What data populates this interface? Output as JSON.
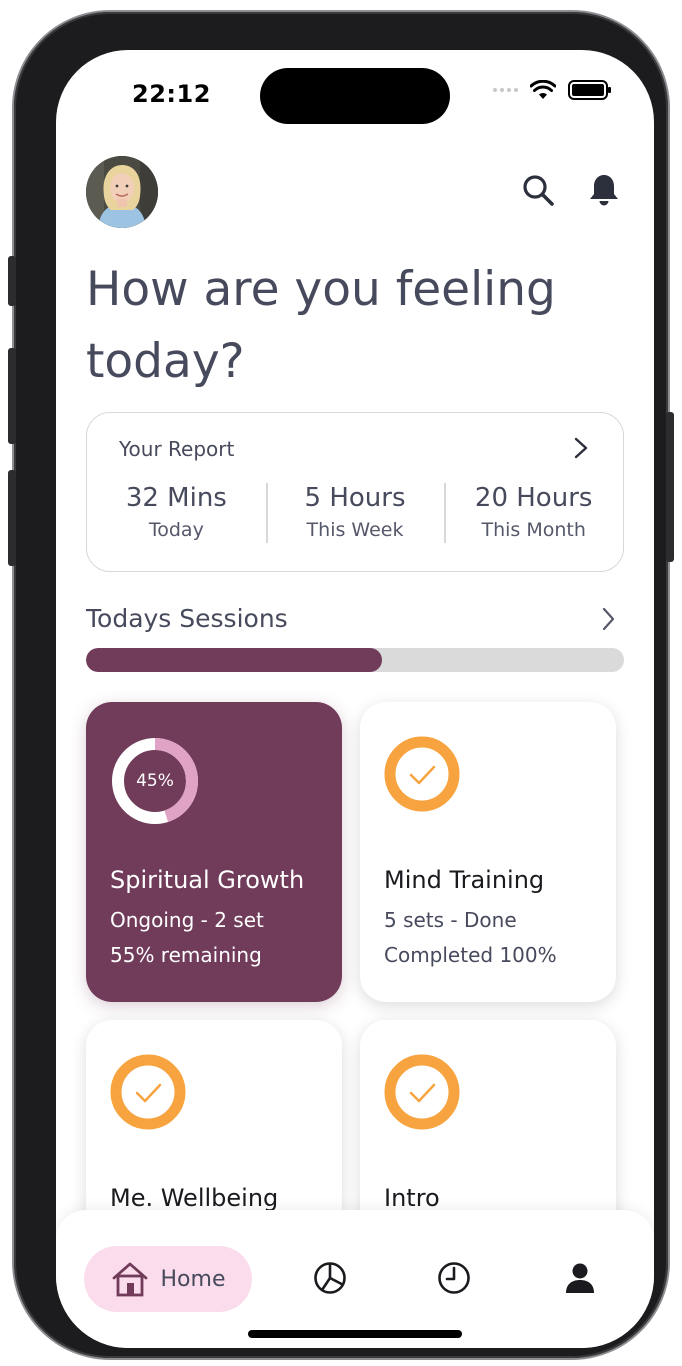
{
  "status_bar": {
    "time": "22:12"
  },
  "header": {
    "avatar_label": "avatar",
    "title": "How are you feeling today?"
  },
  "report": {
    "label": "Your Report",
    "stats": [
      {
        "value": "32 Mins",
        "label": "Today"
      },
      {
        "value": "5 Hours",
        "label": "This Week"
      },
      {
        "value": "20 Hours",
        "label": "This Month"
      }
    ]
  },
  "sessions": {
    "title": "Todays Sessions",
    "progress_percent": 55,
    "cards": [
      {
        "name": "Spiritual Growth",
        "line1": "Ongoing - 2 set",
        "line2": "55% remaining",
        "ring_text": "45%",
        "ring_percent": 45,
        "active": true
      },
      {
        "name": "Mind Training",
        "line1": "5 sets - Done",
        "line2": "Completed 100%",
        "icon": "check-circle-icon",
        "active": false
      },
      {
        "name": "Me. Wellbeing",
        "line1": "",
        "line2": "",
        "icon": "check-circle-icon",
        "active": false
      },
      {
        "name": "Intro",
        "line1": "",
        "line2": "",
        "icon": "check-circle-icon",
        "active": false
      }
    ]
  },
  "tabbar": {
    "home_label": "Home",
    "icons": [
      "home-icon",
      "pie-chart-icon",
      "clock-icon",
      "profile-icon"
    ]
  },
  "colors": {
    "accent": "#713c5a",
    "accent_light": "#e0a3c6",
    "check_orange": "#f7a440",
    "tab_active_bg": "#fbdcec",
    "text_primary": "#474a5c"
  }
}
